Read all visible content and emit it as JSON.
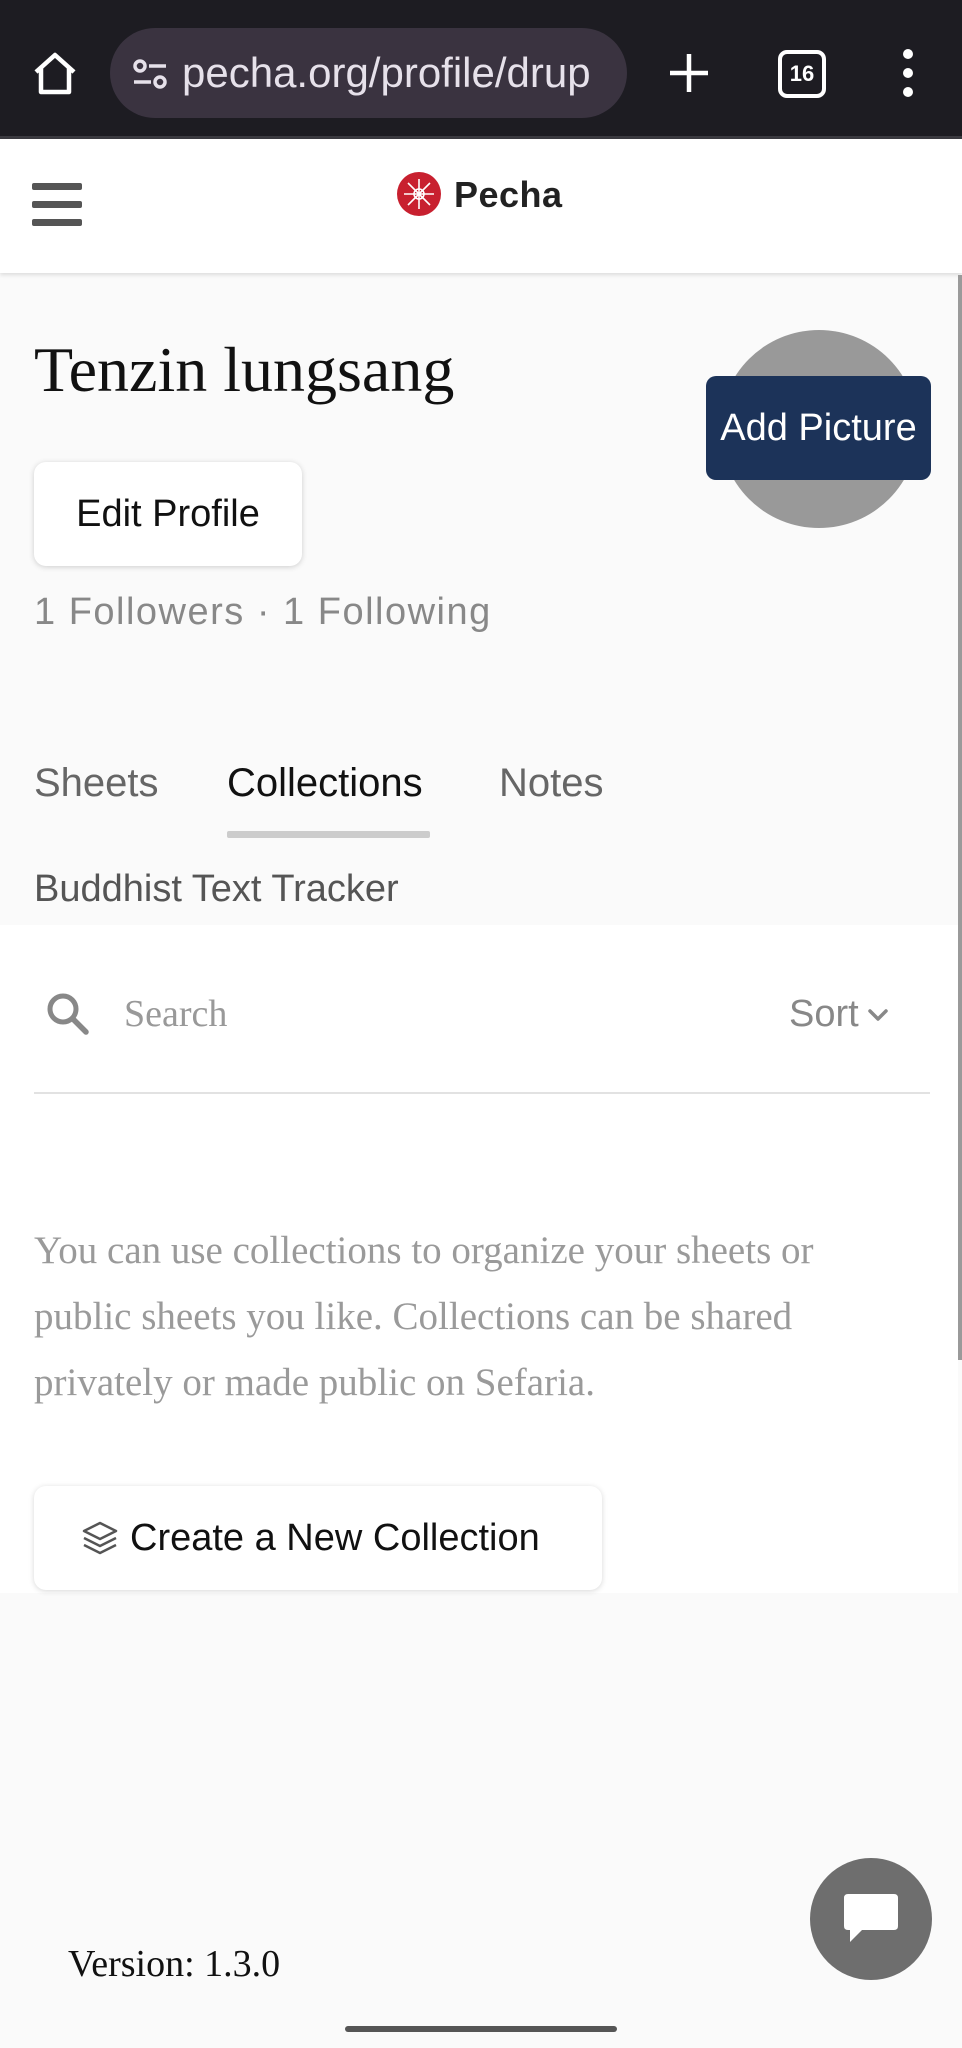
{
  "browser": {
    "url": "pecha.org/profile/drup",
    "tab_count": "16",
    "icons": {
      "home": "home-icon",
      "site_info": "tune-icon",
      "new_tab": "plus-icon",
      "menu": "more-vert-icon"
    }
  },
  "header": {
    "logo_text": "Pecha",
    "brand_color": "#c8202f"
  },
  "profile": {
    "name": "Tenzin lungsang",
    "add_picture_label": "Add Picture",
    "edit_profile_label": "Edit Profile",
    "follow_stats": "1 Followers · 1 Following",
    "accent_color": "#1c3359"
  },
  "tabs": [
    {
      "label": "Sheets",
      "active": false
    },
    {
      "label": "Collections",
      "active": true
    },
    {
      "label": "Notes",
      "active": false
    }
  ],
  "collection": {
    "title": "Buddhist Text Tracker",
    "search_placeholder": "Search",
    "sort_label": "Sort",
    "empty_message": "You can use collections to organize your sheets or public sheets you like. Collections can be shared privately or made public on Sefaria.",
    "create_label": "Create a New Collection"
  },
  "footer": {
    "version": "Version: 1.3.0"
  }
}
